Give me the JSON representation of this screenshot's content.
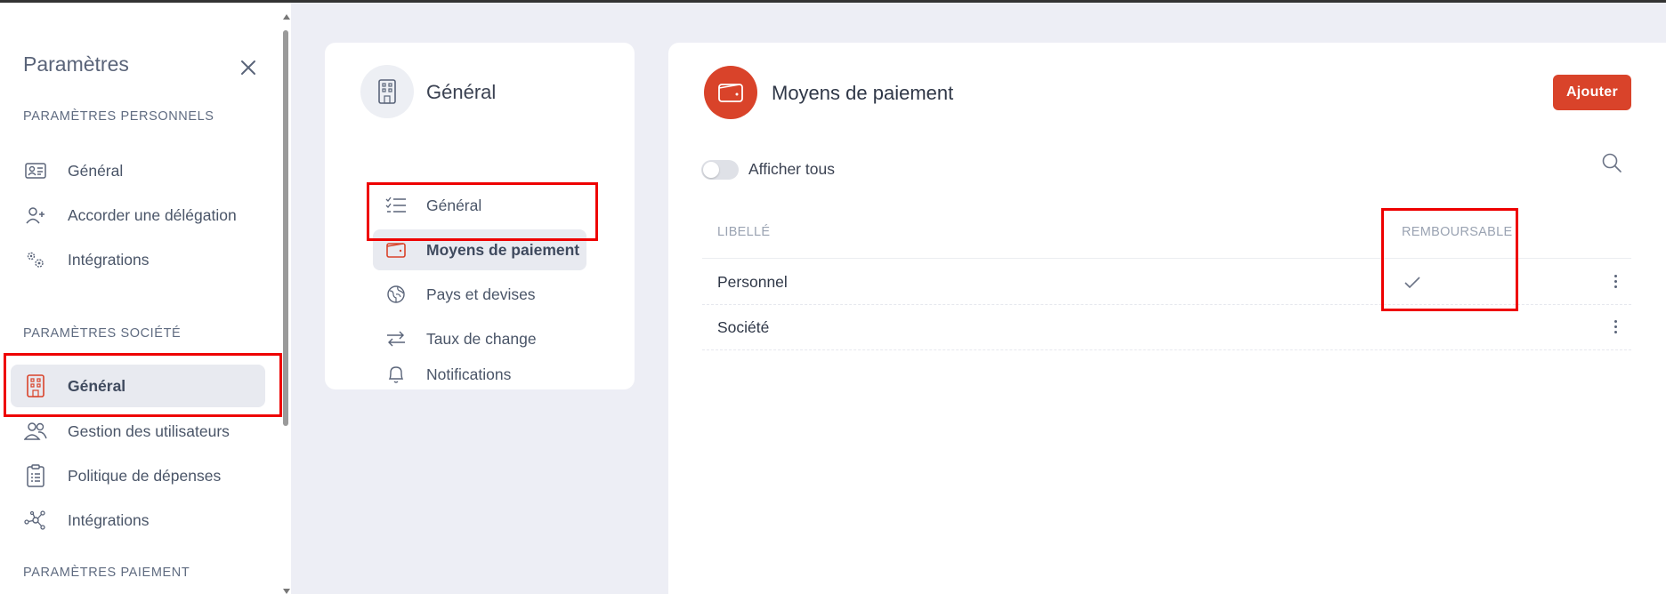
{
  "sidebar": {
    "title": "Paramètres",
    "sections": [
      {
        "label": "PARAMÈTRES PERSONNELS",
        "items": [
          {
            "label": "Général",
            "icon": "id-card-icon"
          },
          {
            "label": "Accorder une délégation",
            "icon": "user-plus-icon"
          },
          {
            "label": "Intégrations",
            "icon": "gears-icon"
          }
        ]
      },
      {
        "label": "PARAMÈTRES SOCIÉTÉ",
        "items": [
          {
            "label": "Général",
            "icon": "building-icon",
            "active": true
          },
          {
            "label": "Gestion des utilisateurs",
            "icon": "users-icon"
          },
          {
            "label": "Politique de dépenses",
            "icon": "clipboard-icon"
          },
          {
            "label": "Intégrations",
            "icon": "network-icon"
          }
        ]
      },
      {
        "label": "PARAMÈTRES PAIEMENT",
        "items": []
      }
    ]
  },
  "middle": {
    "title": "Général",
    "items": [
      {
        "label": "Général",
        "icon": "checklist-icon"
      },
      {
        "label": "Moyens de paiement",
        "icon": "wallet-icon",
        "active": true
      },
      {
        "label": "Pays et devises",
        "icon": "globe-icon"
      },
      {
        "label": "Taux de change",
        "icon": "exchange-icon"
      },
      {
        "label": "Notifications",
        "icon": "bell-icon"
      }
    ]
  },
  "main": {
    "title": "Moyens de paiement",
    "add_label": "Ajouter",
    "toggle_label": "Afficher tous",
    "columns": {
      "libelle": "LIBELLÉ",
      "remboursable": "REMBOURSABLE"
    },
    "rows": [
      {
        "libelle": "Personnel",
        "remboursable": true
      },
      {
        "libelle": "Société",
        "remboursable": false
      }
    ]
  },
  "colors": {
    "accent": "#d9432a",
    "highlight": "#ee0000",
    "active_bg": "#e8eaf0"
  }
}
